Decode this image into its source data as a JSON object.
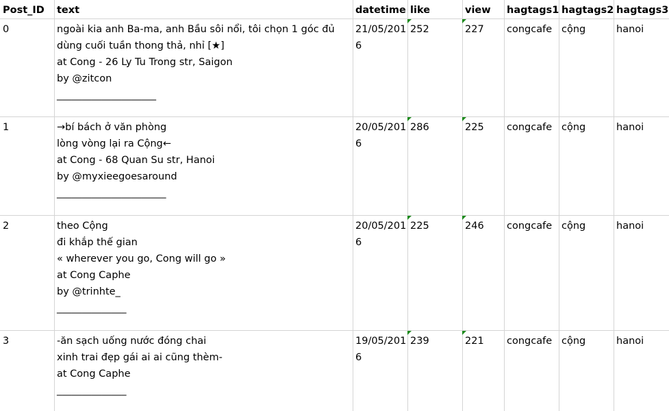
{
  "columns": [
    "Post_ID",
    "text",
    "datetime",
    "like",
    "view",
    "hagtags1",
    "hagtags2",
    "hagtags3"
  ],
  "rows": [
    {
      "post_id": "0",
      "text_lines": [
        "ngoài kia anh Ba-ma, anh Bầu sôi nổi, tôi chọn 1 góc đủ",
        "dùng cuối tuần thong thả, nhỉ [★]",
        "at Cong - 26 Ly Tu Trong str, Saigon",
        "by @zitcon"
      ],
      "rule": "____________________",
      "datetime": "21/05/2016",
      "like": "252",
      "view": "227",
      "hagtags1": "congcafe",
      "hagtags2": "cộng",
      "hagtags3": "hanoi"
    },
    {
      "post_id": "1",
      "text_lines": [
        "→bí bách ở văn phòng",
        "lòng vòng lại ra Cộng←",
        "at Cong - 68 Quan Su str, Hanoi",
        "by @myxieegoesaround"
      ],
      "rule": "______________________",
      "datetime": "20/05/2016",
      "like": "286",
      "view": "225",
      "hagtags1": "congcafe",
      "hagtags2": "cộng",
      "hagtags3": "hanoi"
    },
    {
      "post_id": "2",
      "text_lines": [
        "theo Cộng",
        "đi khắp thế gian",
        "« wherever you go, Cong will go »",
        "at Cong Caphe",
        "by @trinhte_"
      ],
      "rule": "______________",
      "datetime": "20/05/2016",
      "like": "225",
      "view": "246",
      "hagtags1": "congcafe",
      "hagtags2": "cộng",
      "hagtags3": "hanoi"
    },
    {
      "post_id": "3",
      "text_lines": [
        "-ăn sạch uống nước đóng chai",
        "xinh trai đẹp gái ai ai cũng thèm-",
        "at Cong Caphe"
      ],
      "rule": "______________",
      "datetime": "19/05/2016",
      "like": "239",
      "view": "221",
      "hagtags1": "congcafe",
      "hagtags2": "cộng",
      "hagtags3": "hanoi"
    }
  ],
  "colors": {
    "gridline": "#d4d4d4",
    "number_stored_as_text_flag": "#1e8a1e"
  }
}
